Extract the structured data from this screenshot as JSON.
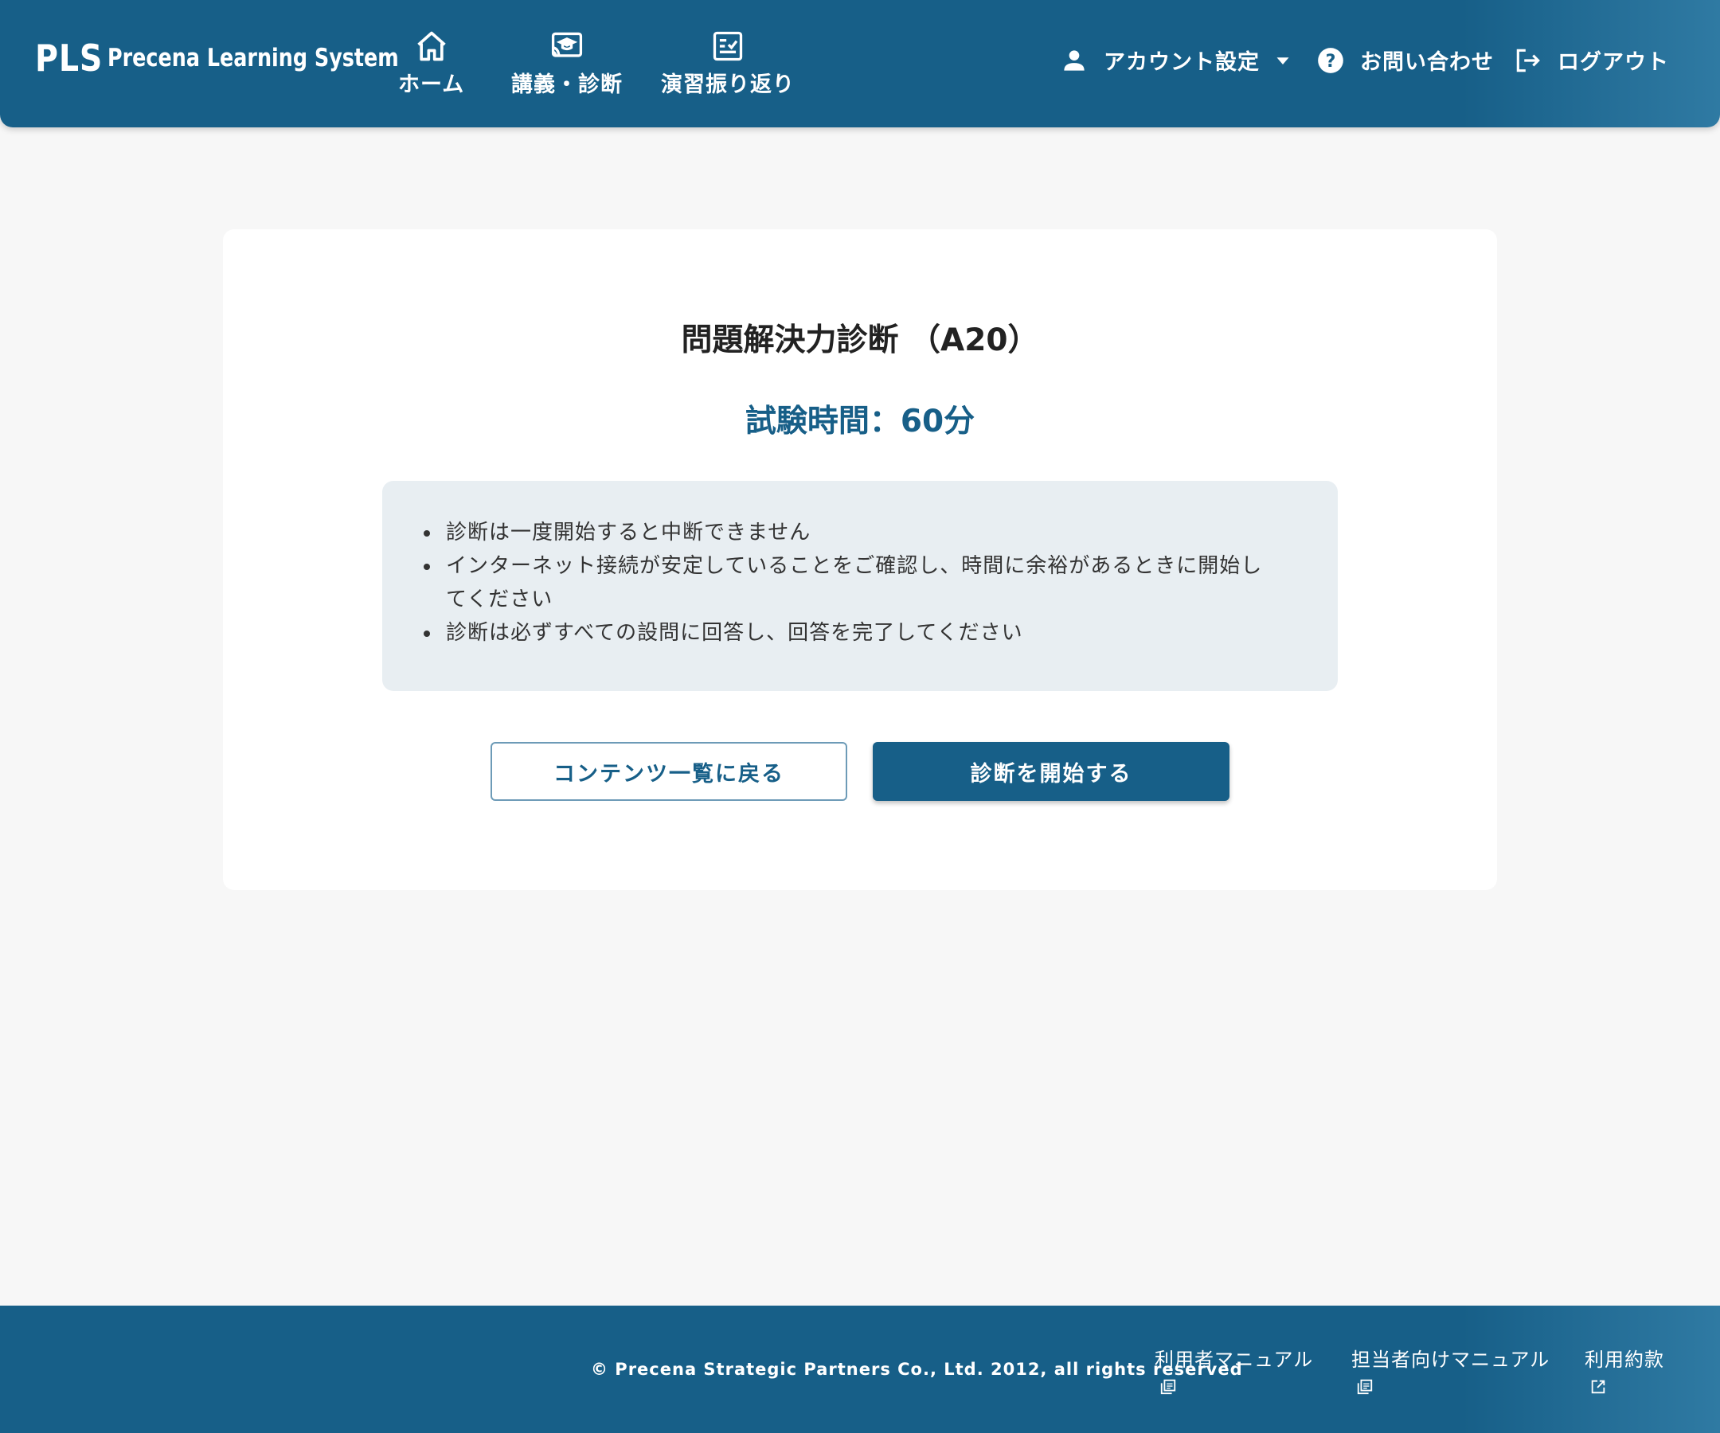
{
  "header": {
    "brand_mark": "PLS",
    "brand_name": "Precena Learning System",
    "nav": [
      {
        "label": "ホーム",
        "icon": "home-icon"
      },
      {
        "label": "講義・診断",
        "icon": "lecture-screen-icon"
      },
      {
        "label": "演習振り返り",
        "icon": "checklist-icon"
      }
    ],
    "account_label": "アカウント設定",
    "contact_label": "お問い合わせ",
    "logout_label": "ログアウト"
  },
  "main": {
    "title": "問題解決力診断 （A20）",
    "exam_time": "試験時間：60分",
    "notes": [
      "診断は一度開始すると中断できません",
      "インターネット接続が安定していることをご確認し、時間に余裕があるときに開始し",
      "てください",
      "診断は必ずすべての設問に回答し、回答を完了してください"
    ],
    "back_button": "コンテンツ一覧に戻る",
    "start_button": "診断を開始する"
  },
  "footer": {
    "copyright": "© Precena Strategic Partners Co., Ltd. 2012, all rights reserved",
    "links": [
      {
        "label": "利用者マニュアル",
        "icon": "pdf-document-icon"
      },
      {
        "label": "担当者向けマニュアル",
        "icon": "pdf-document-icon"
      },
      {
        "label": "利用約款",
        "icon": "external-link-icon"
      }
    ]
  },
  "colors": {
    "primary": "#175f88",
    "background": "#f7f7f7",
    "notice_bg": "#e8eef2"
  }
}
